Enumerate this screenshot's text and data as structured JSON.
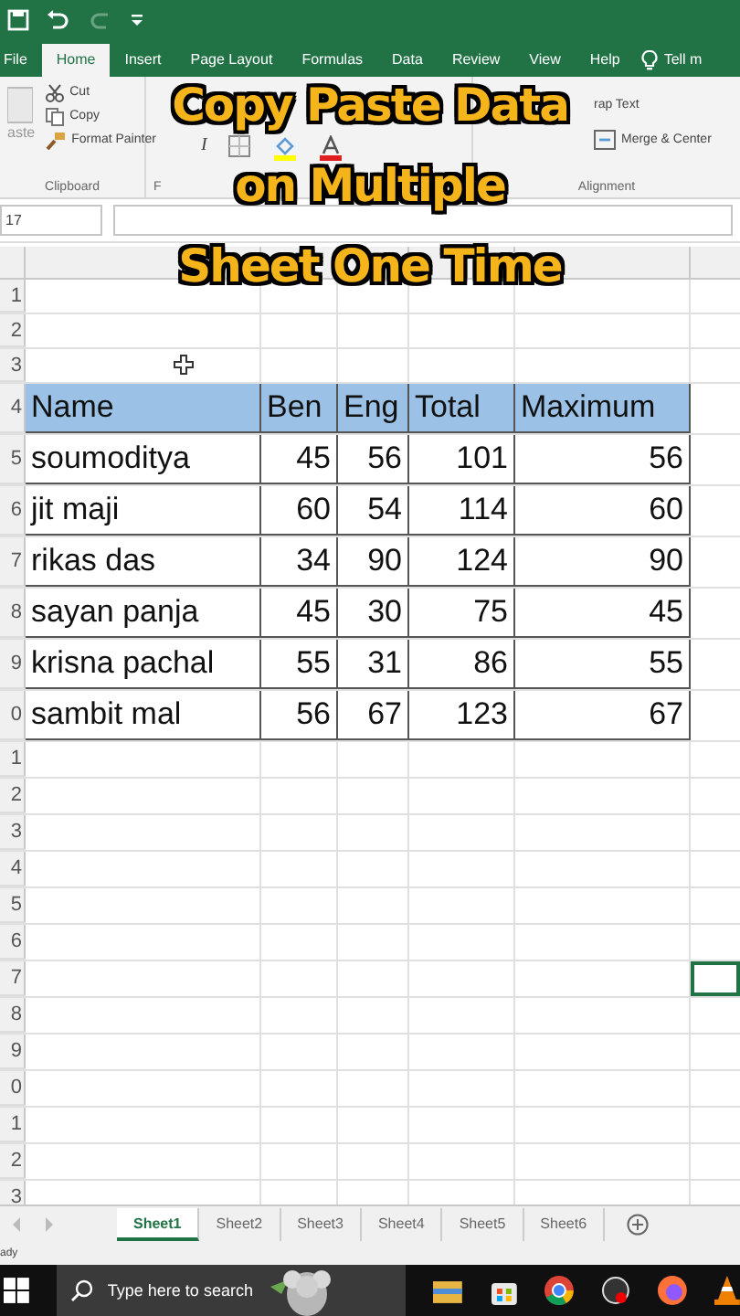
{
  "ribbon_tabs": [
    {
      "label": "File",
      "selected": false
    },
    {
      "label": "Home",
      "selected": true
    },
    {
      "label": "Insert",
      "selected": false
    },
    {
      "label": "Page Layout",
      "selected": false
    },
    {
      "label": "Formulas",
      "selected": false
    },
    {
      "label": "Data",
      "selected": false
    },
    {
      "label": "Review",
      "selected": false
    },
    {
      "label": "View",
      "selected": false
    },
    {
      "label": "Help",
      "selected": false
    }
  ],
  "tell_me": "Tell m",
  "ribbon": {
    "paste": "aste",
    "cut": "Cut",
    "copy": "Copy",
    "format_painter": "Format Painter",
    "clipboard_label": "Clipboard",
    "italic": "I",
    "font_label": "F",
    "wrap_text": "rap Text",
    "merge_center": "Merge & Center",
    "alignment_label": "Alignment"
  },
  "name_box": "17",
  "overlay_title": [
    "Copy Paste Data",
    "on Multiple",
    "Sheet One Time"
  ],
  "row_headers": [
    "1",
    "2",
    "3",
    "4",
    "5",
    "6",
    "7",
    "8",
    "9",
    "0",
    "1",
    "2",
    "3",
    "4",
    "5",
    "6",
    "7",
    "8",
    "9",
    "0",
    "1",
    "2",
    "3"
  ],
  "table": {
    "columns": [
      "Name",
      "Ben",
      "Eng",
      "Total",
      "Maximum"
    ],
    "rows": [
      [
        "soumoditya",
        "45",
        "56",
        "101",
        "56"
      ],
      [
        "jit maji",
        "60",
        "54",
        "114",
        "60"
      ],
      [
        "rikas das",
        "34",
        "90",
        "124",
        "90"
      ],
      [
        "sayan  panja",
        "45",
        "30",
        "75",
        "45"
      ],
      [
        "krisna pachal",
        "55",
        "31",
        "86",
        "55"
      ],
      [
        "sambit mal",
        "56",
        "67",
        "123",
        "67"
      ]
    ]
  },
  "sheet_tabs": [
    {
      "label": "Sheet1",
      "selected": true
    },
    {
      "label": "Sheet2",
      "selected": false
    },
    {
      "label": "Sheet3",
      "selected": false
    },
    {
      "label": "Sheet4",
      "selected": false
    },
    {
      "label": "Sheet5",
      "selected": false
    },
    {
      "label": "Sheet6",
      "selected": false
    }
  ],
  "status": "ady",
  "taskbar": {
    "search_placeholder": "Type here to search"
  }
}
